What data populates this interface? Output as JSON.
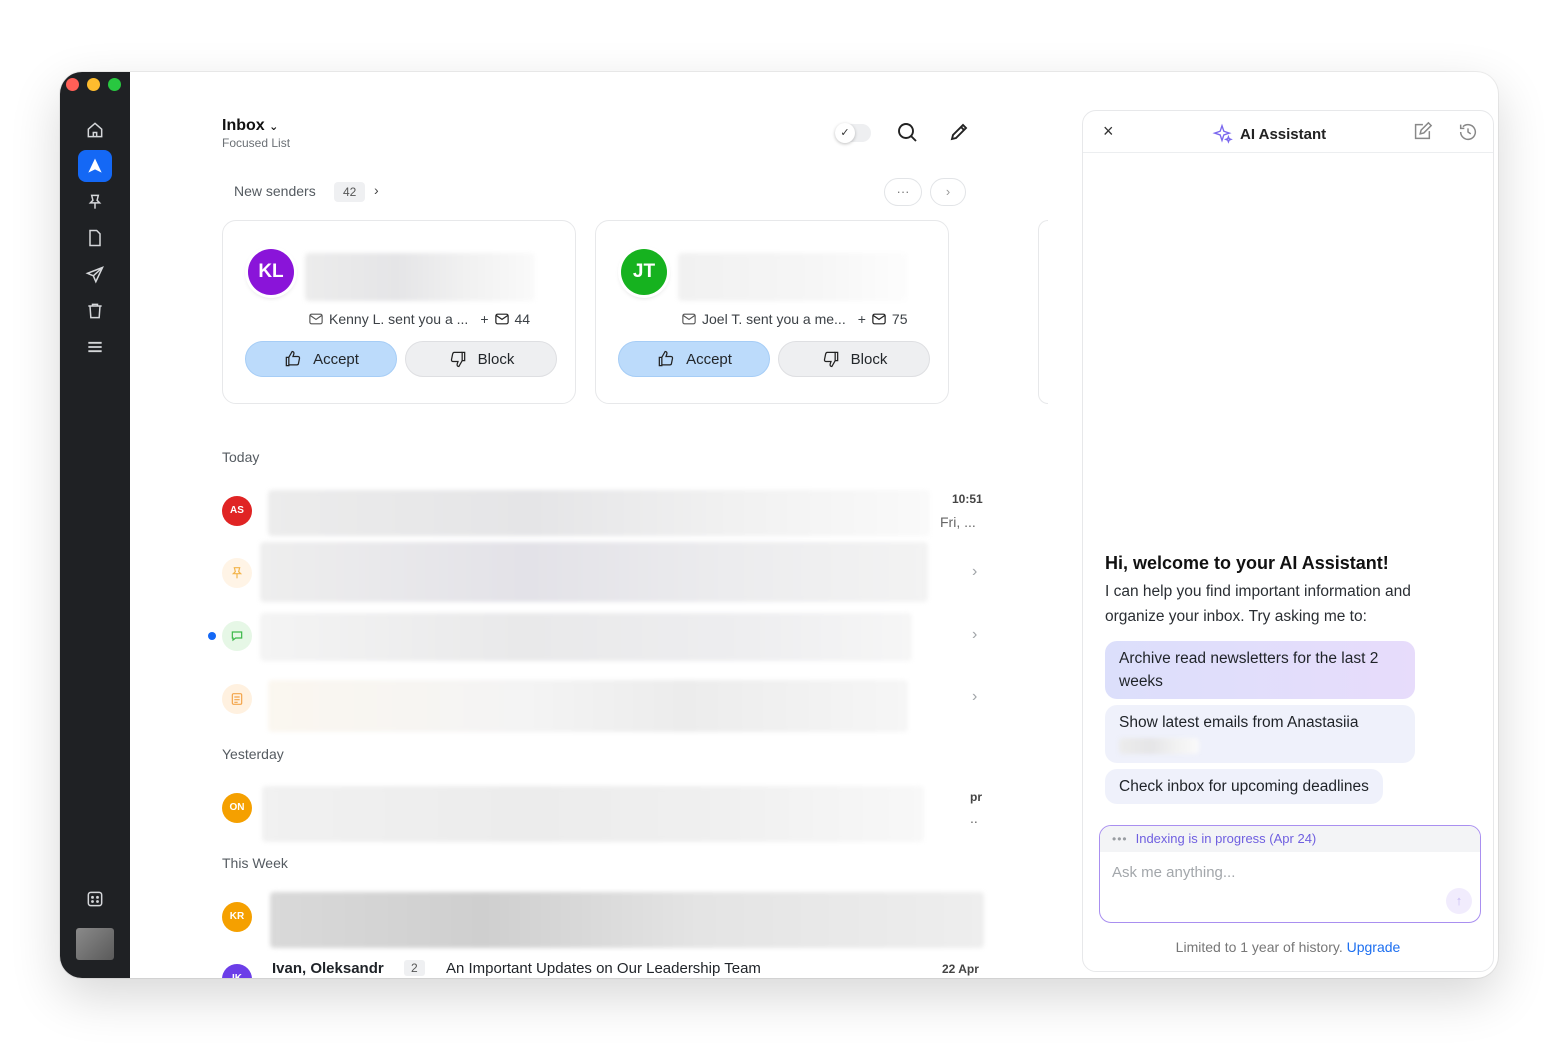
{
  "window": {
    "title": ""
  },
  "sidebar": {
    "items": [
      {
        "name": "home"
      },
      {
        "name": "focused",
        "active": true
      },
      {
        "name": "pinned"
      },
      {
        "name": "drafts"
      },
      {
        "name": "sent"
      },
      {
        "name": "trash"
      },
      {
        "name": "more"
      }
    ]
  },
  "header": {
    "title": "Inbox",
    "subtitle": "Focused List"
  },
  "new_senders": {
    "label": "New senders",
    "count": "42",
    "arrow": "›",
    "more_label": "···",
    "next_label": "›",
    "cards": [
      {
        "initials": "KL",
        "color": "#8a14d9",
        "message": "Kenny L. sent you a ...",
        "plus": "+",
        "count": "44",
        "accept": "Accept",
        "block": "Block"
      },
      {
        "initials": "JT",
        "color": "#16b21f",
        "message": "Joel T. sent you a me...",
        "plus": "+",
        "count": "75",
        "accept": "Accept",
        "block": "Block"
      }
    ]
  },
  "sections": {
    "today": "Today",
    "yesterday": "Yesterday",
    "this_week": "This Week"
  },
  "rows": {
    "as": {
      "initials": "AS",
      "color": "#e02424",
      "time": "10:51",
      "sub": "Fri, ..."
    },
    "on": {
      "initials": "ON",
      "color": "#f5a000",
      "time": "pr",
      "sub": ".."
    },
    "kr": {
      "initials": "KR",
      "color": "#f5a000"
    },
    "last": {
      "initials": "IK",
      "color": "#6c3ee8",
      "sender": "Ivan, Oleksandr",
      "count": "2",
      "subject": "An Important Updates on Our Leadership Team",
      "date": "22 Apr"
    }
  },
  "ai": {
    "title": "AI Assistant",
    "close": "×",
    "welcome_title": "Hi, welcome to your AI Assistant!",
    "welcome_text": "I can help you find important information and organize your inbox. Try asking me to:",
    "suggestions": [
      "Archive read newsletters for the last 2 weeks",
      "Show latest emails from Anastasiia",
      "Check inbox for upcoming deadlines"
    ],
    "indexing": "Indexing is in progress (Apr 24)",
    "indexing_dots": "•••",
    "placeholder": "Ask me anything...",
    "send": "↑",
    "footer_text": "Limited to 1 year of history.",
    "footer_link": "Upgrade"
  },
  "colors": {
    "accent": "#1468f5",
    "sidebar": "#1f2124",
    "accept_btn": "#bcdbfb",
    "ai_border": "#a98ff0"
  }
}
